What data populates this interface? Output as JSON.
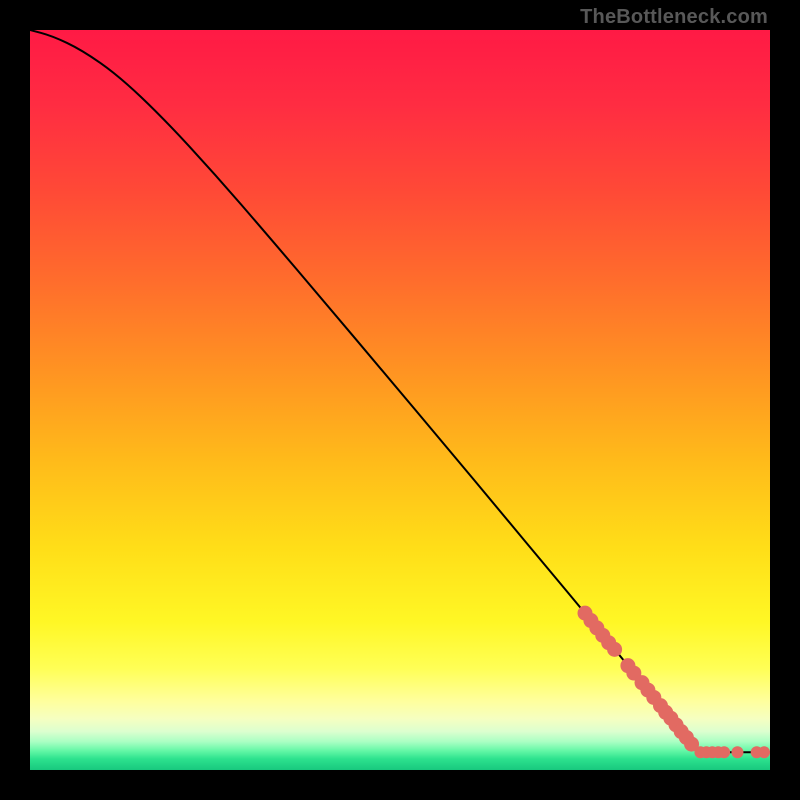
{
  "watermark": "TheBottleneck.com",
  "gradient_stops": [
    {
      "offset": 0.0,
      "color": "#ff1a45"
    },
    {
      "offset": 0.1,
      "color": "#ff2c42"
    },
    {
      "offset": 0.22,
      "color": "#ff4a36"
    },
    {
      "offset": 0.34,
      "color": "#ff6d2c"
    },
    {
      "offset": 0.46,
      "color": "#ff9322"
    },
    {
      "offset": 0.58,
      "color": "#ffba1a"
    },
    {
      "offset": 0.7,
      "color": "#ffde18"
    },
    {
      "offset": 0.8,
      "color": "#fff725"
    },
    {
      "offset": 0.862,
      "color": "#ffff55"
    },
    {
      "offset": 0.905,
      "color": "#ffff9a"
    },
    {
      "offset": 0.93,
      "color": "#f6ffc0"
    },
    {
      "offset": 0.948,
      "color": "#dcffcf"
    },
    {
      "offset": 0.962,
      "color": "#a9ffc3"
    },
    {
      "offset": 0.974,
      "color": "#64f7a6"
    },
    {
      "offset": 0.985,
      "color": "#2de28e"
    },
    {
      "offset": 1.0,
      "color": "#18c87e"
    }
  ],
  "curve_color": "#000000",
  "marker_color": "#e26a62",
  "marker_radius_main": 7.5,
  "marker_radius_small": 6.0,
  "chart_data": {
    "type": "line",
    "title": "",
    "xlabel": "",
    "ylabel": "",
    "xlim": [
      0,
      100
    ],
    "ylim": [
      0,
      100
    ],
    "curve": [
      {
        "x": 0,
        "y": 100.0
      },
      {
        "x": 3,
        "y": 99.2
      },
      {
        "x": 7,
        "y": 97.3
      },
      {
        "x": 12,
        "y": 93.8
      },
      {
        "x": 18,
        "y": 88.1
      },
      {
        "x": 25,
        "y": 80.5
      },
      {
        "x": 32,
        "y": 72.4
      },
      {
        "x": 40,
        "y": 63.0
      },
      {
        "x": 48,
        "y": 53.5
      },
      {
        "x": 56,
        "y": 44.0
      },
      {
        "x": 64,
        "y": 34.4
      },
      {
        "x": 70,
        "y": 27.2
      },
      {
        "x": 75,
        "y": 21.2
      },
      {
        "x": 80,
        "y": 15.1
      },
      {
        "x": 84,
        "y": 10.2
      },
      {
        "x": 87,
        "y": 6.5
      },
      {
        "x": 89,
        "y": 4.0
      },
      {
        "x": 90,
        "y": 2.8
      },
      {
        "x": 91,
        "y": 2.4
      },
      {
        "x": 93,
        "y": 2.4
      },
      {
        "x": 96,
        "y": 2.4
      },
      {
        "x": 100,
        "y": 2.4
      }
    ],
    "markers_on_slope": [
      {
        "x": 75.0,
        "y": 21.2
      },
      {
        "x": 75.8,
        "y": 20.2
      },
      {
        "x": 76.6,
        "y": 19.2
      },
      {
        "x": 77.4,
        "y": 18.2
      },
      {
        "x": 78.2,
        "y": 17.2
      },
      {
        "x": 79.0,
        "y": 16.3
      },
      {
        "x": 80.8,
        "y": 14.1
      },
      {
        "x": 81.6,
        "y": 13.1
      },
      {
        "x": 82.7,
        "y": 11.8
      },
      {
        "x": 83.5,
        "y": 10.8
      },
      {
        "x": 84.3,
        "y": 9.8
      },
      {
        "x": 85.2,
        "y": 8.7
      },
      {
        "x": 85.9,
        "y": 7.8
      },
      {
        "x": 86.6,
        "y": 7.0
      },
      {
        "x": 87.3,
        "y": 6.1
      },
      {
        "x": 88.0,
        "y": 5.2
      },
      {
        "x": 88.7,
        "y": 4.4
      },
      {
        "x": 89.4,
        "y": 3.5
      }
    ],
    "markers_on_flat": [
      {
        "x": 90.6,
        "y": 2.4
      },
      {
        "x": 91.4,
        "y": 2.4
      },
      {
        "x": 92.2,
        "y": 2.4
      },
      {
        "x": 93.0,
        "y": 2.4
      },
      {
        "x": 93.8,
        "y": 2.4
      },
      {
        "x": 95.6,
        "y": 2.4
      },
      {
        "x": 98.2,
        "y": 2.4
      },
      {
        "x": 99.2,
        "y": 2.4
      }
    ]
  }
}
